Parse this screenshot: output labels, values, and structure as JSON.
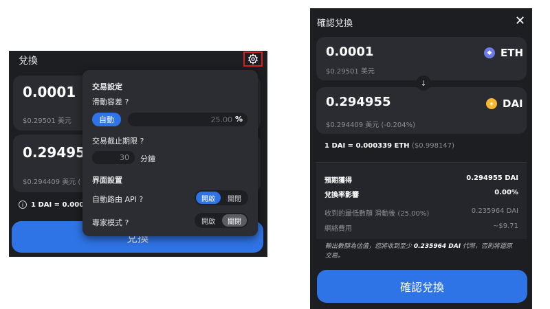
{
  "swap": {
    "title": "兌換",
    "from_amount": "0.0001",
    "from_fiat": "$0.29501 美元",
    "to_amount": "0.29495",
    "to_fiat": "$0.294409 美元 (",
    "rate": "1 DAI = 0.0003",
    "button": "兌換",
    "info_glyph": "i"
  },
  "settings": {
    "title": "交易設定",
    "slippage_label": "滑動容差 ?",
    "auto_label": "自動",
    "slippage_value": "25.00",
    "percent": "%",
    "deadline_label": "交易截止期限 ?",
    "deadline_value": "30",
    "minutes": "分鐘",
    "interface_title": "界面設置",
    "auto_router_label": "自動路由 API ?",
    "expert_label": "專家模式 ?",
    "on": "開啟",
    "off": "關閉"
  },
  "confirm": {
    "title": "確認兌換",
    "close_glyph": "✕",
    "from_amount": "0.0001",
    "from_fiat": "$0.29501 美元",
    "from_token": "ETH",
    "to_amount": "0.294955",
    "to_fiat": "$0.294409 美元 (-0.204%)",
    "to_token": "DAI",
    "arrow_glyph": "↓",
    "rate": "1 DAI = 0.000339 ETH",
    "rate_fiat": "($0.998147)",
    "details": [
      {
        "label": "預期獲得",
        "value": "0.294955 DAI",
        "style": "strong"
      },
      {
        "label": "兌換率影響",
        "value": "0.00%",
        "style": "strong"
      },
      {
        "label": "收到的最低數額 滑動後 (25.00%)",
        "value": "0.235964 DAI",
        "style": "muted"
      },
      {
        "label": "網絡費用",
        "value": "~$9.71",
        "style": "muted"
      }
    ],
    "notice_pre": "輸出數額為估值，您將收到至少 ",
    "notice_amount": "0.235964 DAI",
    "notice_post": " 代幣，否則將還原交易。",
    "button": "確認兌換"
  },
  "colors": {
    "accent": "#2f74e6",
    "highlight_border": "#d32020",
    "panel_bg": "#1d1e22",
    "card_bg": "#2b2c31"
  },
  "icons": {
    "settings": "gear-icon",
    "info": "info-icon",
    "close": "close-icon",
    "arrow": "arrow-down-icon",
    "eth": "eth-token-icon",
    "dai": "dai-token-icon"
  }
}
